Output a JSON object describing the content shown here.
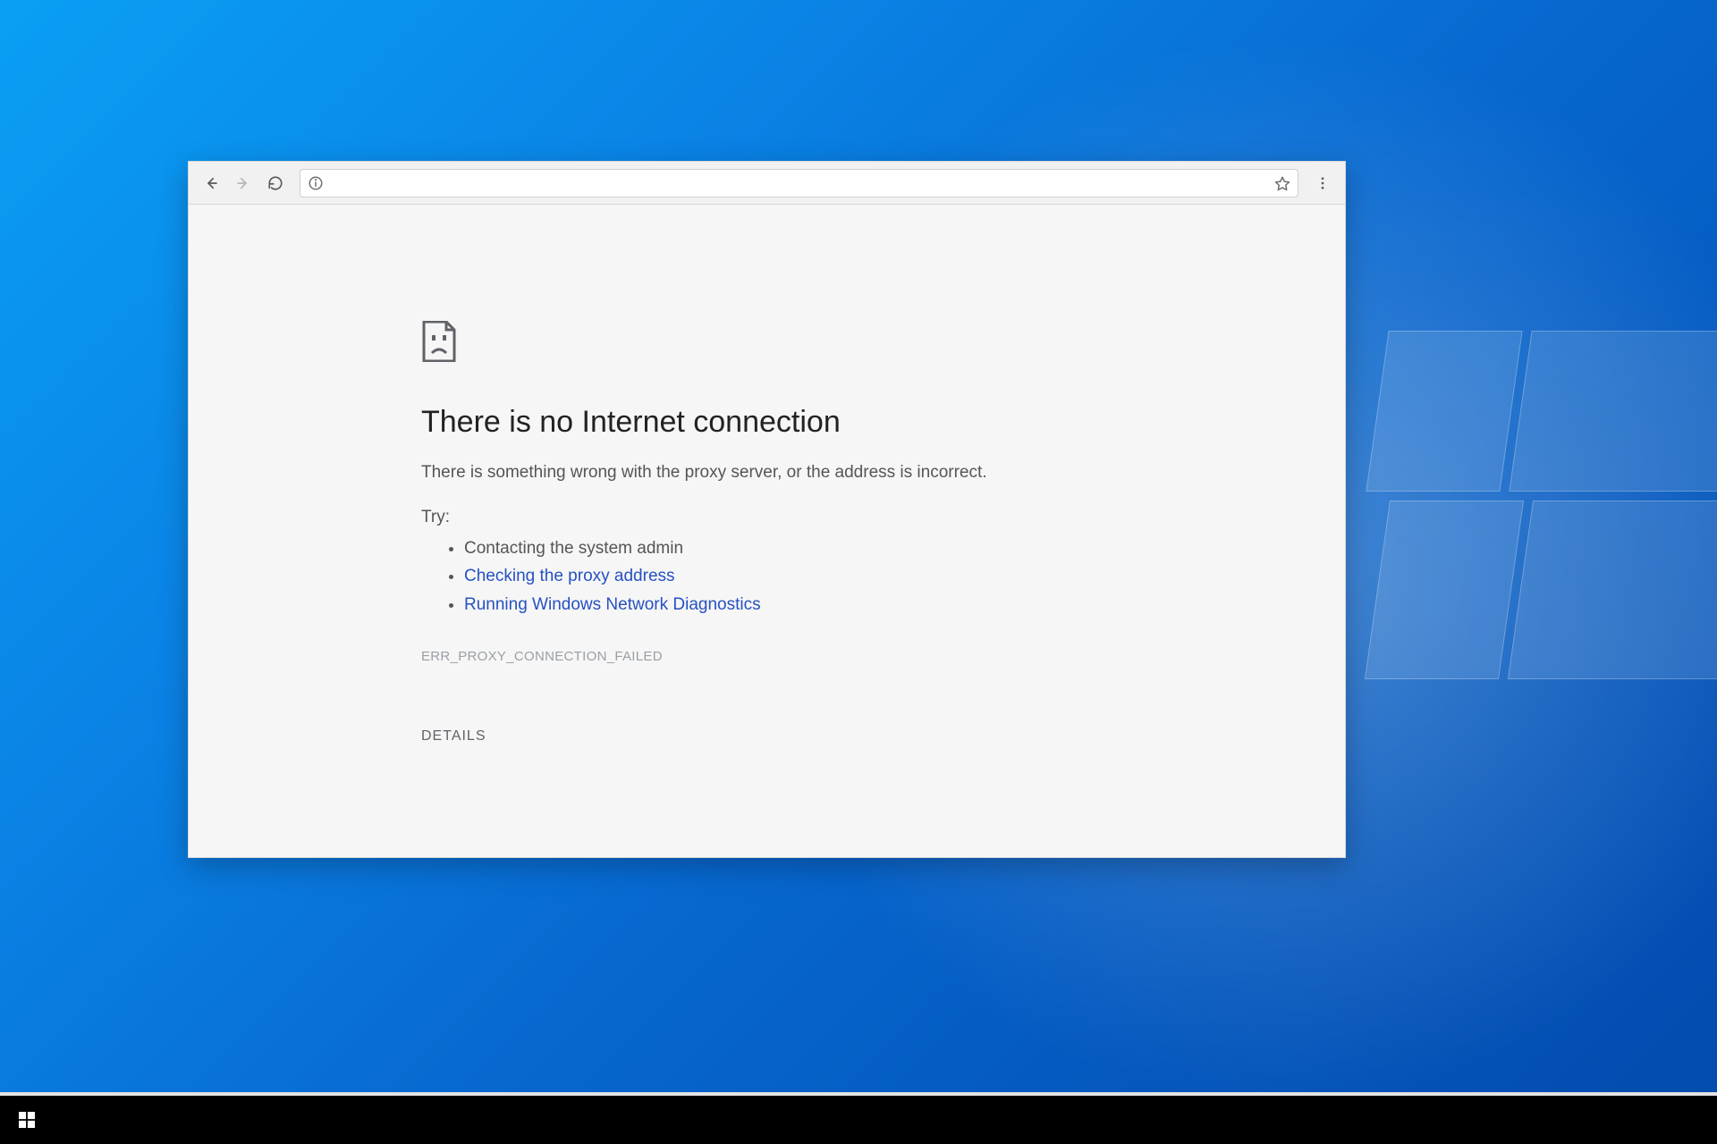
{
  "browser": {
    "toolbar": {
      "address_value": "",
      "address_placeholder": ""
    },
    "error": {
      "title": "There is no Internet connection",
      "subtitle": "There is something wrong with the proxy server, or the address is incorrect.",
      "try_label": "Try:",
      "suggestions": {
        "contact_admin": "Contacting the system admin",
        "check_proxy": "Checking the proxy address",
        "run_diagnostics": "Running Windows Network Diagnostics"
      },
      "error_code": "ERR_PROXY_CONNECTION_FAILED",
      "details_button": "DETAILS"
    }
  }
}
